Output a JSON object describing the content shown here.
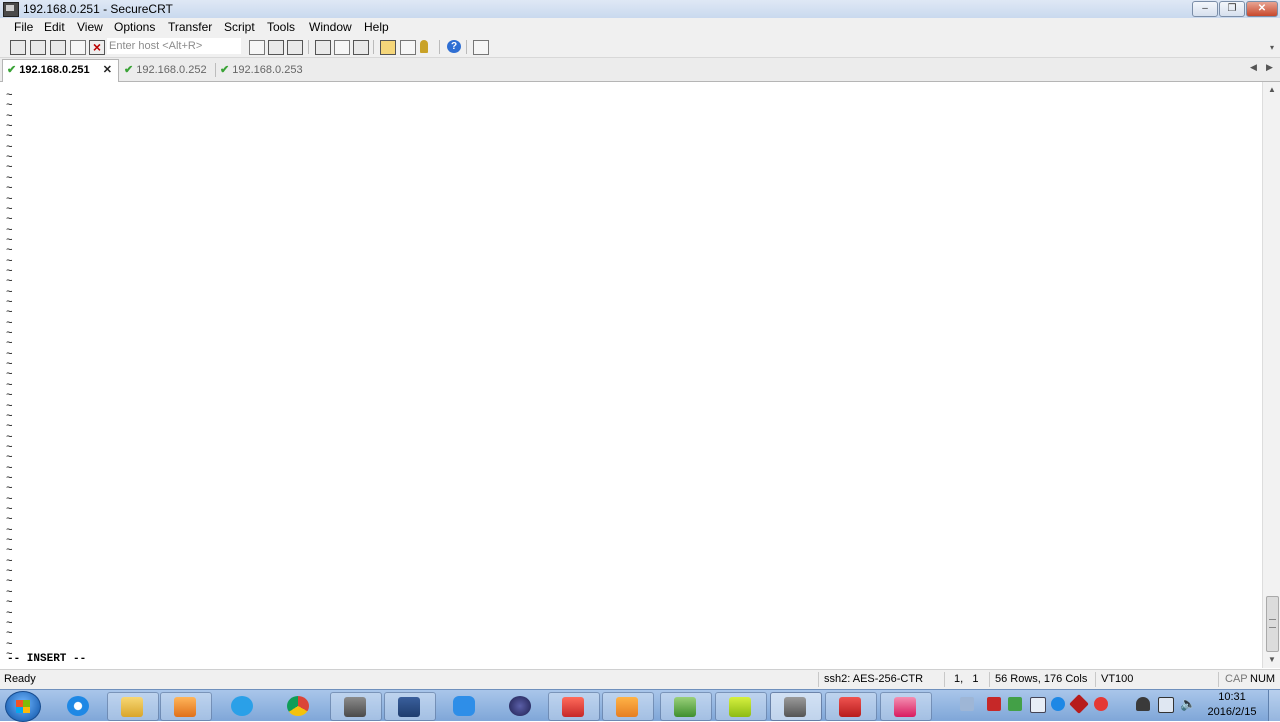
{
  "window": {
    "title": "192.168.0.251 - SecureCRT"
  },
  "menu": [
    "File",
    "Edit",
    "View",
    "Options",
    "Transfer",
    "Script",
    "Tools",
    "Window",
    "Help"
  ],
  "toolbar": {
    "host_placeholder": "Enter host <Alt+R>"
  },
  "tabs": [
    {
      "label": "192.168.0.251",
      "active": true
    },
    {
      "label": "192.168.0.252",
      "active": false
    },
    {
      "label": "192.168.0.253",
      "active": false
    }
  ],
  "terminal": {
    "tilde_char": "~",
    "tilde_rows": 55,
    "mode_line": "-- INSERT --"
  },
  "status": {
    "ready": "Ready",
    "encryption": "ssh2: AES-256-CTR",
    "cursor": "1,   1",
    "size": "56 Rows, 176 Cols",
    "emulation": "VT100",
    "cap": "CAP",
    "num": "NUM"
  },
  "taskbar": {
    "apps": [
      "internet-explorer",
      "file-explorer",
      "media-player",
      "cloud-sync",
      "chrome",
      "tool-app",
      "app-lock",
      "feather-app",
      "eclipse",
      "red-app",
      "orange-app",
      "pdf-app",
      "m-app",
      "securecrt",
      "red-tool",
      "pink-tool"
    ],
    "clock_time": "10:31",
    "clock_date": "2016/2/15"
  }
}
